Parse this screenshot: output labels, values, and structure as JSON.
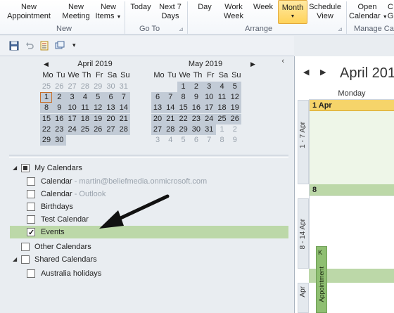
{
  "ribbon": {
    "new_group": {
      "label": "New",
      "buttons": [
        {
          "line1": "New",
          "line2": "Appointment"
        },
        {
          "line1": "New",
          "line2": "Meeting"
        },
        {
          "line1": "New",
          "line2": "Items"
        }
      ]
    },
    "goto_group": {
      "label": "Go To",
      "buttons": [
        {
          "line1": "Today",
          "line2": ""
        },
        {
          "line1": "Next 7",
          "line2": "Days"
        }
      ]
    },
    "arrange_group": {
      "label": "Arrange",
      "buttons": [
        {
          "line1": "Day",
          "line2": ""
        },
        {
          "line1": "Work",
          "line2": "Week"
        },
        {
          "line1": "Week",
          "line2": ""
        },
        {
          "line1": "Month",
          "line2": ""
        },
        {
          "line1": "Schedule",
          "line2": "View"
        }
      ]
    },
    "manage_group": {
      "label": "Manage Ca",
      "buttons": [
        {
          "line1": "Open",
          "line2": "Calendar"
        },
        {
          "line1": "C",
          "line2": "G"
        }
      ]
    },
    "active_button": "Month"
  },
  "mini_calendars": {
    "days_of_week": [
      "Mo",
      "Tu",
      "We",
      "Th",
      "Fr",
      "Sa",
      "Su"
    ],
    "april": {
      "title": "April 2019",
      "weeks": [
        [
          "25",
          "26",
          "27",
          "28",
          "29",
          "30",
          "31"
        ],
        [
          "1",
          "2",
          "3",
          "4",
          "5",
          "6",
          "7"
        ],
        [
          "8",
          "9",
          "10",
          "11",
          "12",
          "13",
          "14"
        ],
        [
          "15",
          "16",
          "17",
          "18",
          "19",
          "20",
          "21"
        ],
        [
          "22",
          "23",
          "24",
          "25",
          "26",
          "27",
          "28"
        ],
        [
          "29",
          "30",
          "",
          "",
          "",
          "",
          ""
        ]
      ]
    },
    "may": {
      "title": "May 2019",
      "weeks": [
        [
          "",
          "",
          "1",
          "2",
          "3",
          "4",
          "5"
        ],
        [
          "6",
          "7",
          "8",
          "9",
          "10",
          "11",
          "12"
        ],
        [
          "13",
          "14",
          "15",
          "16",
          "17",
          "18",
          "19"
        ],
        [
          "20",
          "21",
          "22",
          "23",
          "24",
          "25",
          "26"
        ],
        [
          "27",
          "28",
          "29",
          "30",
          "31",
          "1",
          "2"
        ],
        [
          "3",
          "4",
          "5",
          "6",
          "7",
          "8",
          "9"
        ]
      ]
    }
  },
  "calendar_tree": {
    "my_calendars": "My Calendars",
    "items": [
      {
        "label": "Calendar",
        "sub": " - martin@beliefmedia.onmicrosoft.com"
      },
      {
        "label": "Calendar",
        "sub": " - Outlook"
      },
      {
        "label": "Birthdays",
        "sub": ""
      },
      {
        "label": "Test Calendar",
        "sub": ""
      },
      {
        "label": "Events",
        "sub": ""
      }
    ],
    "other_calendars": "Other Calendars",
    "shared_calendars": "Shared Calendars",
    "shared_items": [
      {
        "label": "Australia holidays"
      }
    ]
  },
  "main_calendar": {
    "title": "April 201",
    "day_header": "Monday",
    "weeks": [
      {
        "tab": "1 - 7 Apr",
        "day_label": "1 Apr"
      },
      {
        "tab": "8 - 14 Apr",
        "day_label": "8"
      },
      {
        "tab": "Apr",
        "day_label": ""
      }
    ],
    "side_panel_label": "Appointment"
  },
  "colors": {
    "ribbon_active": "#ffd35a",
    "selected_week": "#c2cbd6",
    "events_highlight": "#bcd8a8",
    "first_day_header": "#f6d46a",
    "week_header_green": "#bcd8a8"
  }
}
